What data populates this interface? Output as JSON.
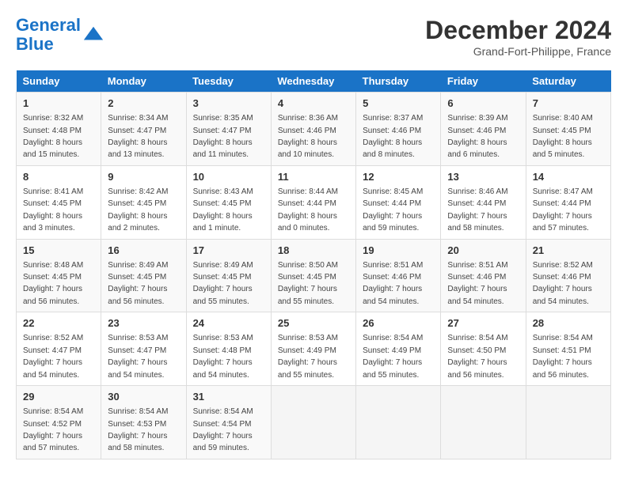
{
  "header": {
    "logo_line1": "General",
    "logo_line2": "Blue",
    "month_title": "December 2024",
    "location": "Grand-Fort-Philippe, France"
  },
  "days_of_week": [
    "Sunday",
    "Monday",
    "Tuesday",
    "Wednesday",
    "Thursday",
    "Friday",
    "Saturday"
  ],
  "weeks": [
    [
      {
        "day": 1,
        "info": "Sunrise: 8:32 AM\nSunset: 4:48 PM\nDaylight: 8 hours\nand 15 minutes."
      },
      {
        "day": 2,
        "info": "Sunrise: 8:34 AM\nSunset: 4:47 PM\nDaylight: 8 hours\nand 13 minutes."
      },
      {
        "day": 3,
        "info": "Sunrise: 8:35 AM\nSunset: 4:47 PM\nDaylight: 8 hours\nand 11 minutes."
      },
      {
        "day": 4,
        "info": "Sunrise: 8:36 AM\nSunset: 4:46 PM\nDaylight: 8 hours\nand 10 minutes."
      },
      {
        "day": 5,
        "info": "Sunrise: 8:37 AM\nSunset: 4:46 PM\nDaylight: 8 hours\nand 8 minutes."
      },
      {
        "day": 6,
        "info": "Sunrise: 8:39 AM\nSunset: 4:46 PM\nDaylight: 8 hours\nand 6 minutes."
      },
      {
        "day": 7,
        "info": "Sunrise: 8:40 AM\nSunset: 4:45 PM\nDaylight: 8 hours\nand 5 minutes."
      }
    ],
    [
      {
        "day": 8,
        "info": "Sunrise: 8:41 AM\nSunset: 4:45 PM\nDaylight: 8 hours\nand 3 minutes."
      },
      {
        "day": 9,
        "info": "Sunrise: 8:42 AM\nSunset: 4:45 PM\nDaylight: 8 hours\nand 2 minutes."
      },
      {
        "day": 10,
        "info": "Sunrise: 8:43 AM\nSunset: 4:45 PM\nDaylight: 8 hours\nand 1 minute."
      },
      {
        "day": 11,
        "info": "Sunrise: 8:44 AM\nSunset: 4:44 PM\nDaylight: 8 hours\nand 0 minutes."
      },
      {
        "day": 12,
        "info": "Sunrise: 8:45 AM\nSunset: 4:44 PM\nDaylight: 7 hours\nand 59 minutes."
      },
      {
        "day": 13,
        "info": "Sunrise: 8:46 AM\nSunset: 4:44 PM\nDaylight: 7 hours\nand 58 minutes."
      },
      {
        "day": 14,
        "info": "Sunrise: 8:47 AM\nSunset: 4:44 PM\nDaylight: 7 hours\nand 57 minutes."
      }
    ],
    [
      {
        "day": 15,
        "info": "Sunrise: 8:48 AM\nSunset: 4:45 PM\nDaylight: 7 hours\nand 56 minutes."
      },
      {
        "day": 16,
        "info": "Sunrise: 8:49 AM\nSunset: 4:45 PM\nDaylight: 7 hours\nand 56 minutes."
      },
      {
        "day": 17,
        "info": "Sunrise: 8:49 AM\nSunset: 4:45 PM\nDaylight: 7 hours\nand 55 minutes."
      },
      {
        "day": 18,
        "info": "Sunrise: 8:50 AM\nSunset: 4:45 PM\nDaylight: 7 hours\nand 55 minutes."
      },
      {
        "day": 19,
        "info": "Sunrise: 8:51 AM\nSunset: 4:46 PM\nDaylight: 7 hours\nand 54 minutes."
      },
      {
        "day": 20,
        "info": "Sunrise: 8:51 AM\nSunset: 4:46 PM\nDaylight: 7 hours\nand 54 minutes."
      },
      {
        "day": 21,
        "info": "Sunrise: 8:52 AM\nSunset: 4:46 PM\nDaylight: 7 hours\nand 54 minutes."
      }
    ],
    [
      {
        "day": 22,
        "info": "Sunrise: 8:52 AM\nSunset: 4:47 PM\nDaylight: 7 hours\nand 54 minutes."
      },
      {
        "day": 23,
        "info": "Sunrise: 8:53 AM\nSunset: 4:47 PM\nDaylight: 7 hours\nand 54 minutes."
      },
      {
        "day": 24,
        "info": "Sunrise: 8:53 AM\nSunset: 4:48 PM\nDaylight: 7 hours\nand 54 minutes."
      },
      {
        "day": 25,
        "info": "Sunrise: 8:53 AM\nSunset: 4:49 PM\nDaylight: 7 hours\nand 55 minutes."
      },
      {
        "day": 26,
        "info": "Sunrise: 8:54 AM\nSunset: 4:49 PM\nDaylight: 7 hours\nand 55 minutes."
      },
      {
        "day": 27,
        "info": "Sunrise: 8:54 AM\nSunset: 4:50 PM\nDaylight: 7 hours\nand 56 minutes."
      },
      {
        "day": 28,
        "info": "Sunrise: 8:54 AM\nSunset: 4:51 PM\nDaylight: 7 hours\nand 56 minutes."
      }
    ],
    [
      {
        "day": 29,
        "info": "Sunrise: 8:54 AM\nSunset: 4:52 PM\nDaylight: 7 hours\nand 57 minutes."
      },
      {
        "day": 30,
        "info": "Sunrise: 8:54 AM\nSunset: 4:53 PM\nDaylight: 7 hours\nand 58 minutes."
      },
      {
        "day": 31,
        "info": "Sunrise: 8:54 AM\nSunset: 4:54 PM\nDaylight: 7 hours\nand 59 minutes."
      },
      null,
      null,
      null,
      null
    ]
  ]
}
